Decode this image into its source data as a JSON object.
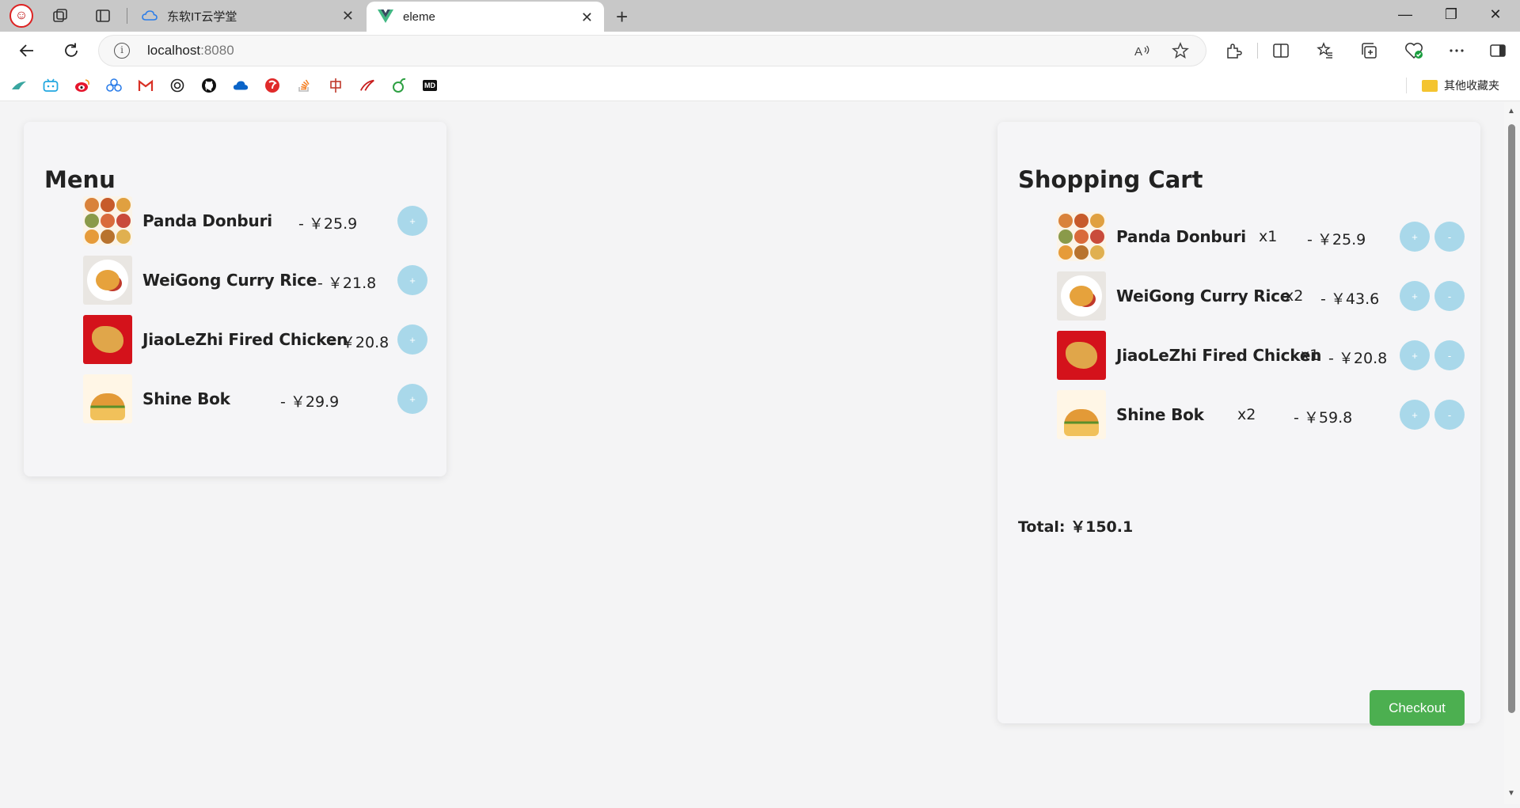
{
  "browser": {
    "tabs": [
      {
        "title": "东软IT云学堂",
        "active": false
      },
      {
        "title": "eleme",
        "active": true
      }
    ],
    "url_host": "localhost",
    "url_port": ":8080",
    "other_bookmarks_label": "其他收藏夹",
    "bookmark_icons": [
      "feather-icon",
      "bilibili-icon",
      "weibo-icon",
      "cloud-service-icon",
      "gmail-icon",
      "openai-icon",
      "github-icon",
      "onedrive-icon",
      "red-circle-icon",
      "stackoverflow-icon",
      "chinese-char-icon",
      "red-swoosh-icon",
      "green-leaf-icon",
      "md-icon"
    ],
    "bookmark_md_text": "MD"
  },
  "menu": {
    "title": "Menu",
    "add_label": "+",
    "items": [
      {
        "name": "Panda Donburi",
        "price": "- ￥25.9"
      },
      {
        "name": "WeiGong Curry Rice",
        "price": "- ￥21.8"
      },
      {
        "name": "JiaoLeZhi Fired Chicken",
        "price": "- ￥20.8"
      },
      {
        "name": "Shine Bok",
        "price": "- ￥29.9"
      }
    ]
  },
  "cart": {
    "title": "Shopping Cart",
    "add_label": "+",
    "remove_label": "-",
    "items": [
      {
        "name": "Panda Donburi",
        "qty": "x1",
        "price": "- ￥25.9"
      },
      {
        "name": "WeiGong Curry Rice",
        "qty": "x2",
        "price": "- ￥43.6"
      },
      {
        "name": "JiaoLeZhi Fired Chicken",
        "qty": "x1",
        "price": "- ￥20.8"
      },
      {
        "name": "Shine Bok",
        "qty": "x2",
        "price": "- ￥59.8"
      }
    ],
    "total": "Total: ￥150.1",
    "checkout_label": "Checkout"
  },
  "colors": {
    "accent_button": "#a9d8ea",
    "checkout": "#4caf50"
  }
}
